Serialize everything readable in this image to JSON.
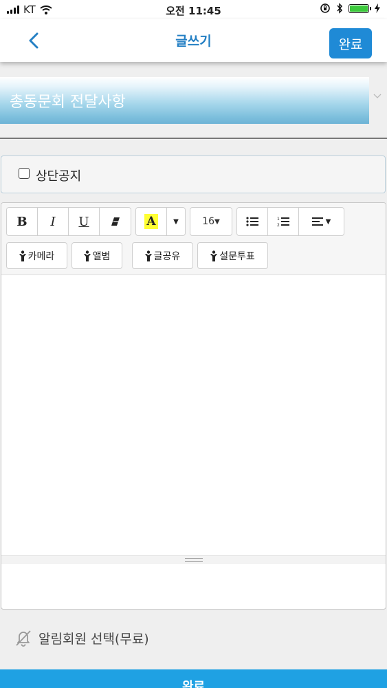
{
  "status_bar": {
    "carrier": "KT",
    "time": "오전 11:45",
    "battery_level": 1.0
  },
  "nav": {
    "title": "글쓰기",
    "done_label": "완료",
    "back_icon": "chevron-left-icon"
  },
  "board": {
    "selected": "총동문회 전달사항",
    "dropdown_icon": "chevron-down-icon"
  },
  "top_notice": {
    "label": "상단공지",
    "checked": false
  },
  "editor": {
    "toolbar": {
      "bold": "B",
      "italic": "I",
      "underline": "U",
      "color_letter": "A",
      "font_size": "16",
      "insert_buttons": [
        {
          "label": "카메라"
        },
        {
          "label": "앨범"
        },
        {
          "label": "글공유"
        },
        {
          "label": "설문투표"
        }
      ]
    },
    "content": ""
  },
  "alert_members": {
    "label": "알림회원 선택(무료)",
    "icon": "bell-off-icon"
  },
  "bottom_button": {
    "label": "완료"
  },
  "colors": {
    "accent": "#1f8ad6",
    "title_blue": "#2580c4",
    "bottom_bar": "#1fa1e3",
    "highlight_yellow": "#ffff33",
    "battery_green": "#3cc93c"
  }
}
